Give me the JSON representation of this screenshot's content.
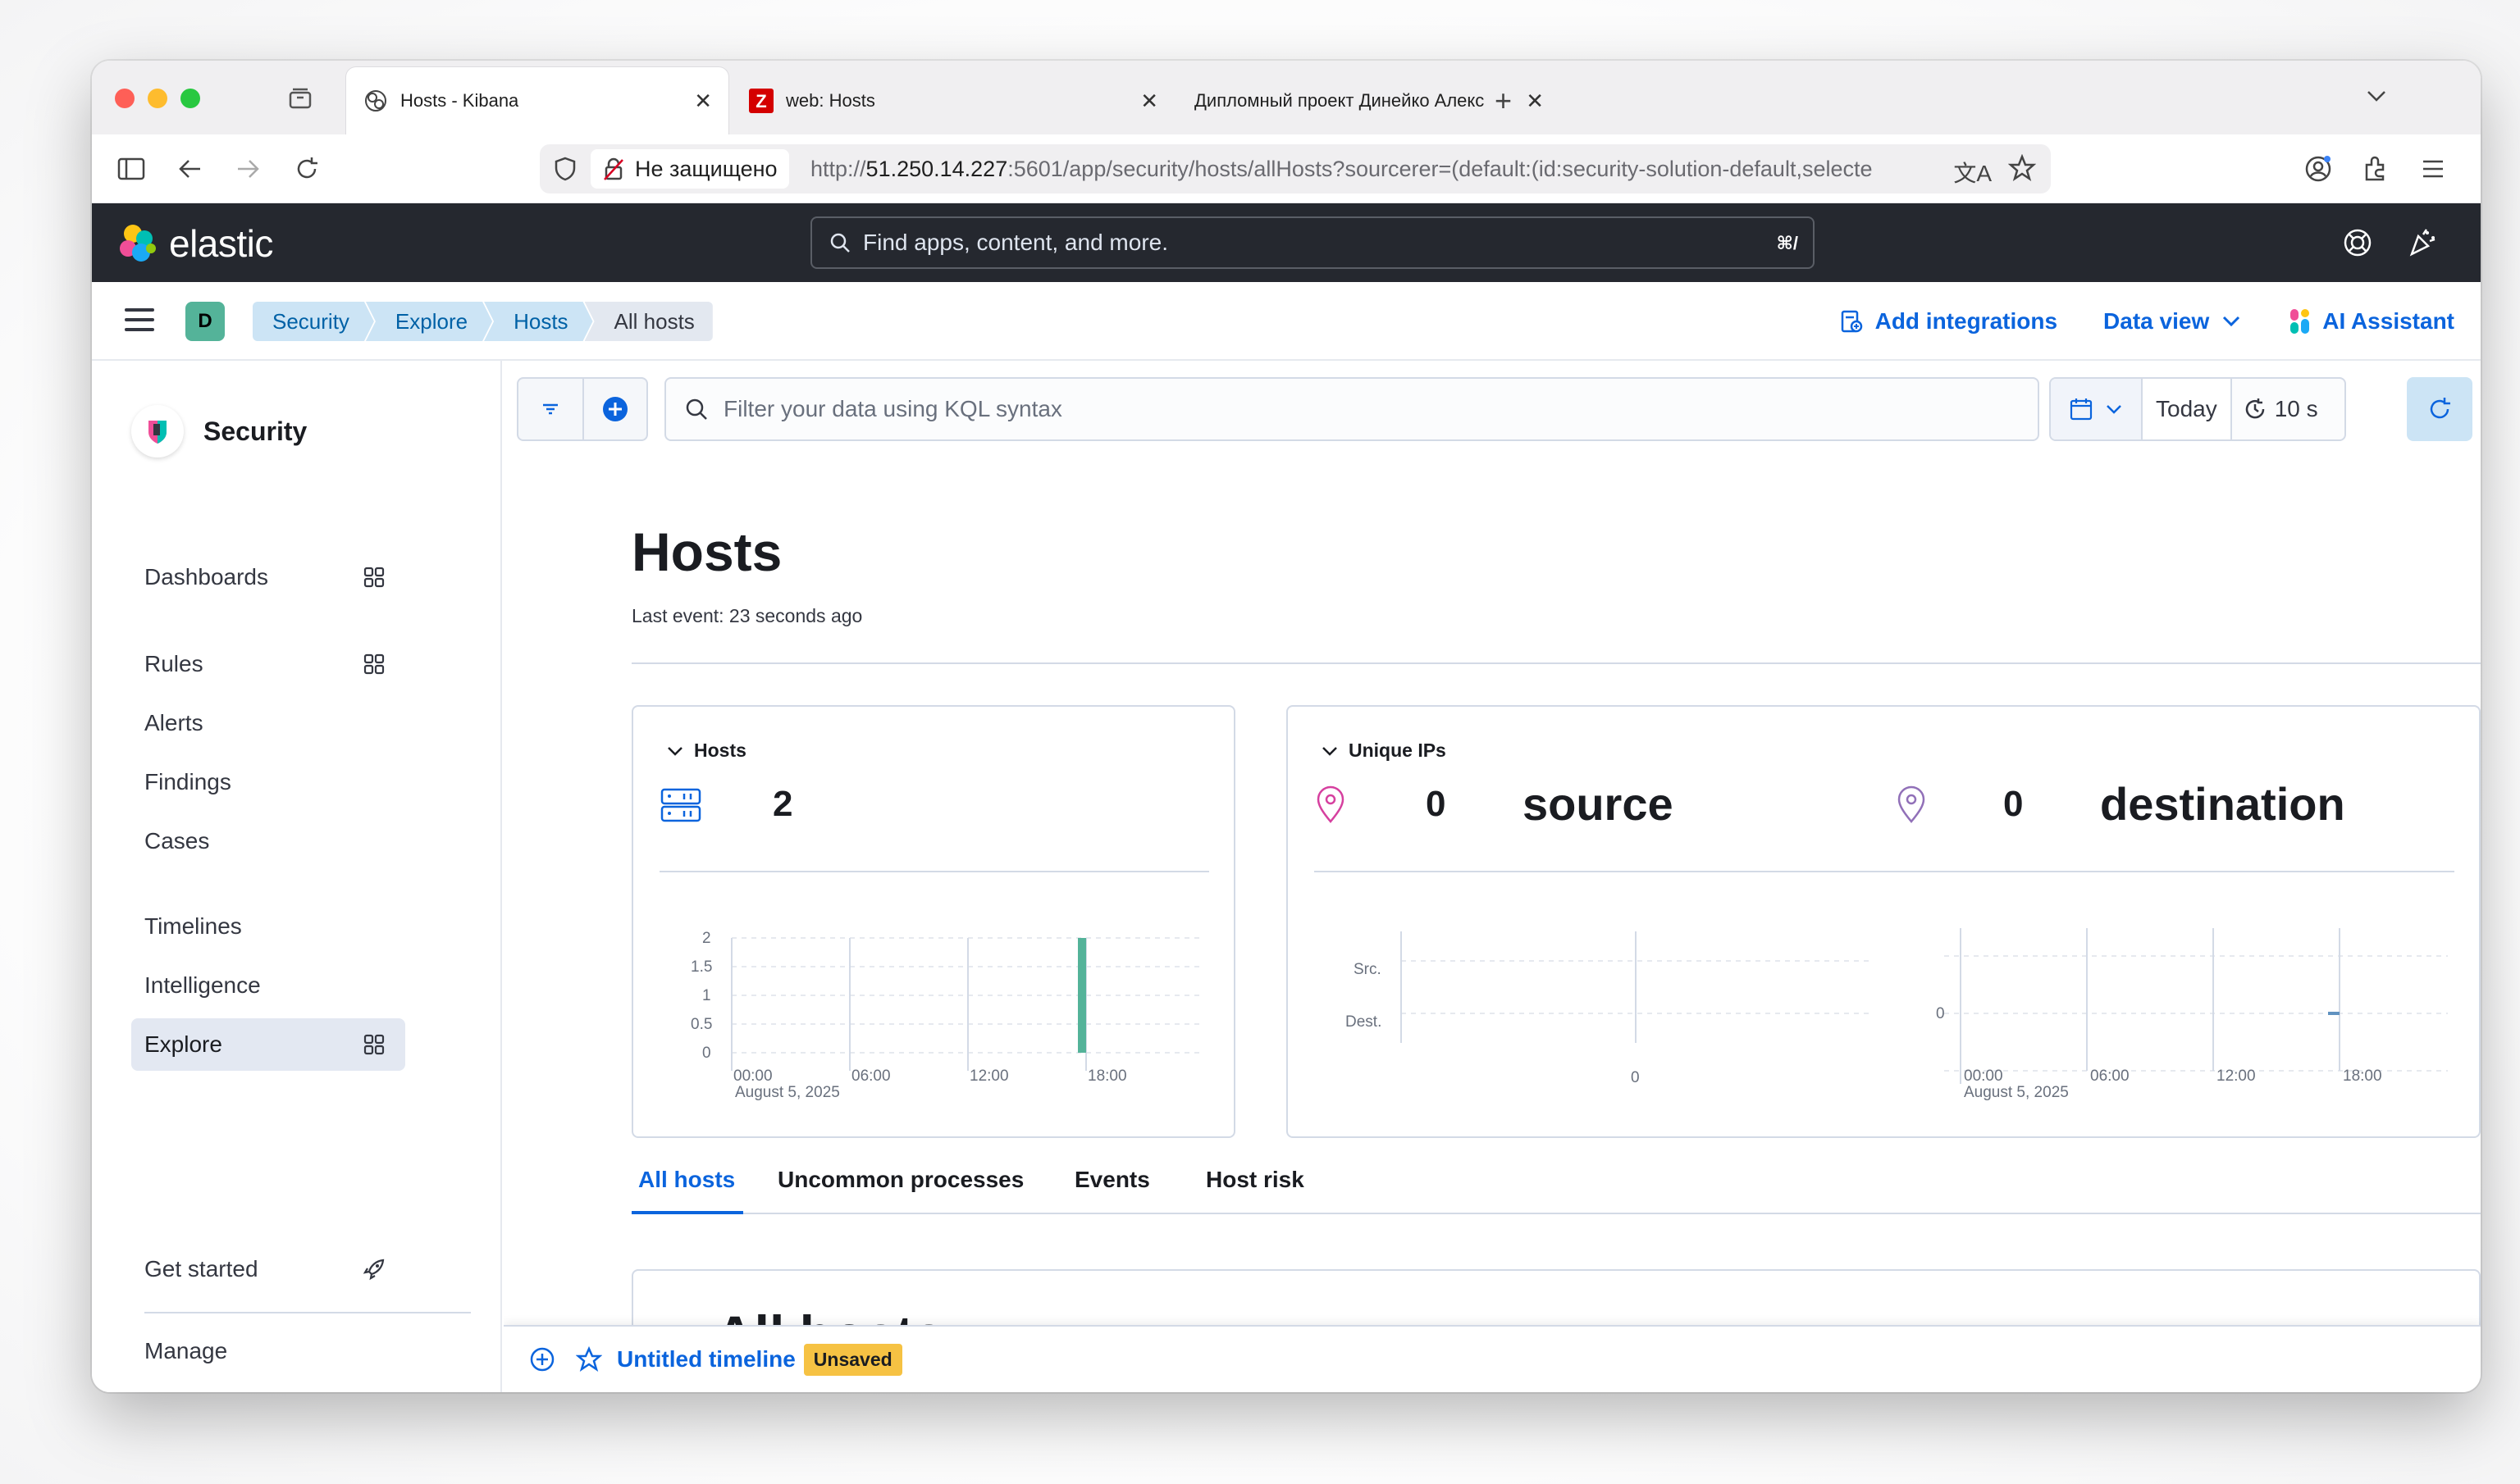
{
  "browser": {
    "tabs": [
      {
        "label": "Hosts - Kibana",
        "active": true
      },
      {
        "label": "web: Hosts",
        "active": false
      },
      {
        "label": "Дипломный проект Динейко Алекс",
        "active": false
      }
    ],
    "url_security": "Не защищено",
    "url_prefix": "http://",
    "url_host": "51.250.14.227",
    "url_rest": ":5601/app/security/hosts/allHosts?sourcerer=(default:(id:security-solution-default,selecte"
  },
  "header": {
    "logo_text": "elastic",
    "search_placeholder": "Find apps, content, and more.",
    "search_shortcut": "⌘/"
  },
  "crumbbar": {
    "space_initial": "D",
    "breadcrumbs": [
      "Security",
      "Explore",
      "Hosts",
      "All hosts"
    ],
    "add_integrations": "Add integrations",
    "data_view": "Data view",
    "ai_assistant": "AI Assistant"
  },
  "sidebar": {
    "title": "Security",
    "items": [
      {
        "label": "Dashboards"
      },
      {
        "label": "Rules"
      },
      {
        "label": "Alerts"
      },
      {
        "label": "Findings"
      },
      {
        "label": "Cases"
      },
      {
        "label": "Timelines"
      },
      {
        "label": "Intelligence"
      },
      {
        "label": "Explore"
      },
      {
        "label": "Get started"
      },
      {
        "label": "Manage"
      }
    ]
  },
  "querybar": {
    "placeholder": "Filter your data using KQL syntax",
    "date_label": "Today",
    "refresh_interval": "10 s"
  },
  "page": {
    "title": "Hosts",
    "last_event": "Last event: 23 seconds ago"
  },
  "hosts_panel": {
    "title": "Hosts",
    "count": "2",
    "y_ticks": [
      "2",
      "1.5",
      "1",
      "0.5",
      "0"
    ],
    "x_ticks": [
      "00:00",
      "06:00",
      "12:00",
      "18:00"
    ],
    "date_label": "August 5, 2025"
  },
  "ips_panel": {
    "title": "Unique IPs",
    "source_count": "0",
    "source_label": "source",
    "dest_count": "0",
    "dest_label": "destination",
    "bar_y_labels": [
      "Src.",
      "Dest."
    ],
    "bar_x_label": "0",
    "area_y_label": "0",
    "x_ticks": [
      "00:00",
      "06:00",
      "12:00",
      "18:00"
    ],
    "date_label": "August 5, 2025"
  },
  "tabs": [
    "All hosts",
    "Uncommon processes",
    "Events",
    "Host risk"
  ],
  "all_hosts_title": "All hosts",
  "timeline": {
    "title": "Untitled timeline",
    "badge": "Unsaved"
  },
  "chart_data": [
    {
      "type": "bar",
      "title": "Hosts",
      "x": [
        "00:00",
        "06:00",
        "12:00",
        "18:00"
      ],
      "x_date": "August 5, 2025",
      "ylim": [
        0,
        2
      ],
      "series": [
        {
          "values": [
            0,
            0,
            0,
            2
          ]
        }
      ]
    },
    {
      "type": "bar",
      "title": "Unique IPs",
      "categories": [
        "Src.",
        "Dest."
      ],
      "values": [
        0,
        0
      ]
    }
  ]
}
